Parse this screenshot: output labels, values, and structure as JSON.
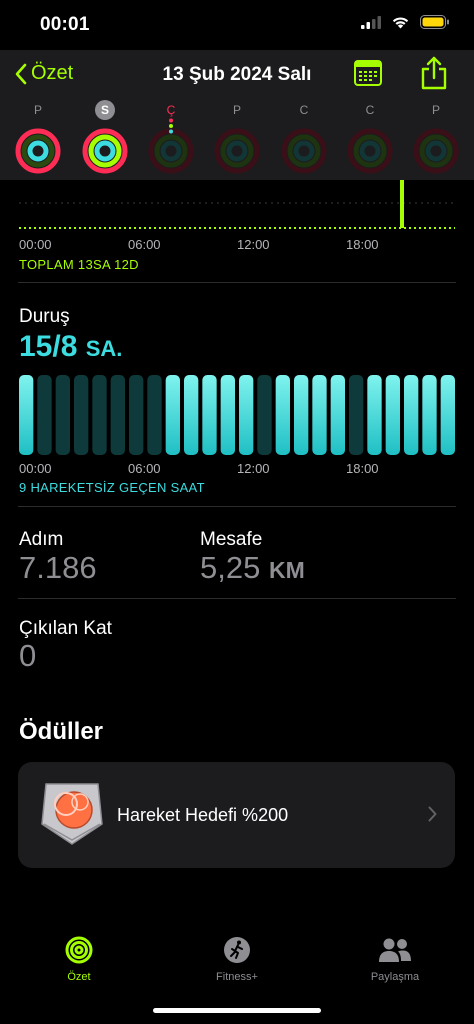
{
  "status": {
    "time": "00:01"
  },
  "nav": {
    "back_label": "Özet",
    "title": "13 Şub 2024 Salı",
    "calendar_icon": "calendar-icon",
    "share_icon": "share-icon"
  },
  "week": [
    {
      "letter": "P",
      "state": "active"
    },
    {
      "letter": "S",
      "state": "selected"
    },
    {
      "letter": "Ç",
      "state": "today"
    },
    {
      "letter": "P",
      "state": "future"
    },
    {
      "letter": "C",
      "state": "future"
    },
    {
      "letter": "C",
      "state": "future"
    },
    {
      "letter": "P",
      "state": "future"
    }
  ],
  "exercise": {
    "times": [
      "00:00",
      "06:00",
      "12:00",
      "18:00"
    ],
    "total": "TOPLAM 13SA 12D"
  },
  "stand": {
    "label": "Duruş",
    "value": "15/8",
    "unit": "SA.",
    "times": [
      "00:00",
      "06:00",
      "12:00",
      "18:00"
    ],
    "note": "9 HAREKETSİZ GEÇEN SAAT",
    "hours": [
      1,
      0,
      0,
      0,
      0,
      0,
      0,
      0,
      1,
      1,
      1,
      1,
      1,
      0,
      1,
      1,
      1,
      1,
      0,
      1,
      1,
      1,
      1,
      1
    ]
  },
  "steps": {
    "label": "Adım",
    "value": "7.186"
  },
  "distance": {
    "label": "Mesafe",
    "value": "5,25",
    "unit": "KM"
  },
  "floors": {
    "label": "Çıkılan Kat",
    "value": "0"
  },
  "awards": {
    "title": "Ödüller",
    "items": [
      {
        "name": "Hareket Hedefi %200"
      }
    ]
  },
  "tabs": [
    {
      "label": "Özet",
      "icon": "activity-rings-icon",
      "active": true
    },
    {
      "label": "Fitness+",
      "icon": "running-figure-icon",
      "active": false
    },
    {
      "label": "Paylaşma",
      "icon": "people-icon",
      "active": false
    }
  ],
  "colors": {
    "move": "#ff2d55",
    "exercise": "#a6ff00",
    "stand": "#3cdce0",
    "background": "#000000",
    "card": "#1c1c1e"
  }
}
